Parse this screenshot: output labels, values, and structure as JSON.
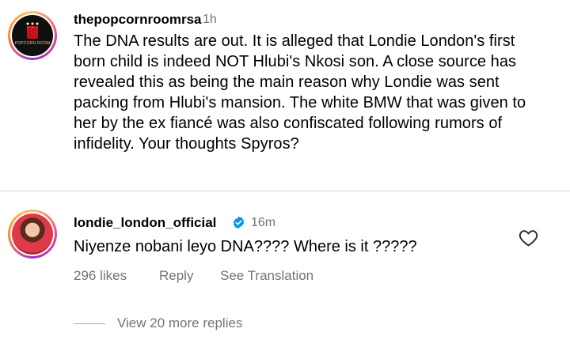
{
  "post": {
    "username": "thepopcornroomrsa",
    "time": "1h",
    "avatar_logo_text": "POPCORN ROOM",
    "text": "The DNA results are out. It is alleged that Londie London's first born child is indeed NOT Hlubi's Nkosi son. A close source has revealed this as being the main reason why Londie was sent packing from Hlubi's mansion. The white BMW that was given to her by the ex fiancé was also confiscated following rumors of infidelity. Your thoughts Spyros?"
  },
  "reply": {
    "username": "londie_london_official",
    "verified_icon": "verified-badge-icon",
    "time": "16m",
    "text": "Niyenze nobani leyo DNA???? Where is it ?????",
    "likes": "296 likes",
    "reply_label": "Reply",
    "translate_label": "See Translation",
    "like_icon": "heart-outline-icon"
  },
  "view_more": "View 20 more replies",
  "colors": {
    "text": "#000000",
    "secondary": "#737373",
    "verified": "#0095f6",
    "divider": "#dbdbdb"
  }
}
